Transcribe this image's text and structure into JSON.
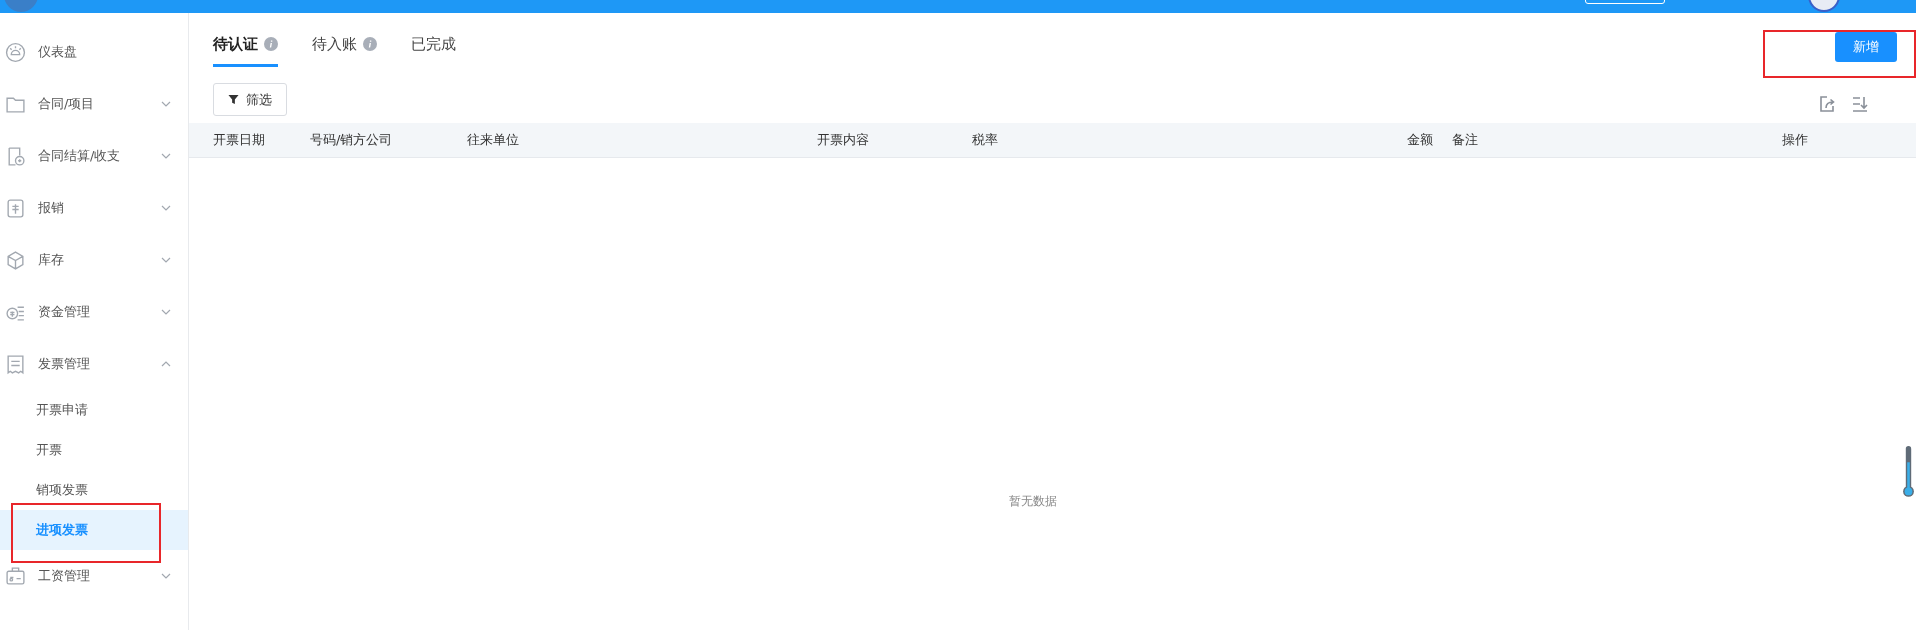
{
  "sidebar": {
    "items": [
      {
        "label": "仪表盘"
      },
      {
        "label": "合同/项目",
        "expanded": false
      },
      {
        "label": "合同结算/收支",
        "expanded": false
      },
      {
        "label": "报销",
        "expanded": false
      },
      {
        "label": "库存",
        "expanded": false
      },
      {
        "label": "资金管理",
        "expanded": false
      },
      {
        "label": "发票管理",
        "expanded": true,
        "children": [
          {
            "label": "开票申请",
            "selected": false
          },
          {
            "label": "开票",
            "selected": false
          },
          {
            "label": "销项发票",
            "selected": false
          },
          {
            "label": "进项发票",
            "selected": true
          }
        ]
      },
      {
        "label": "工资管理",
        "expanded": false
      }
    ]
  },
  "tabs": [
    {
      "label": "待认证",
      "info": true,
      "selected": true
    },
    {
      "label": "待入账",
      "info": true,
      "selected": false
    },
    {
      "label": "已完成",
      "info": false,
      "selected": false
    }
  ],
  "filter_button": "筛选",
  "add_button": "新增",
  "table": {
    "columns": [
      "开票日期",
      "号码/销方公司",
      "往来单位",
      "开票内容",
      "税率",
      "金额",
      "备注",
      "操作"
    ],
    "empty_text": "暂无数据"
  }
}
